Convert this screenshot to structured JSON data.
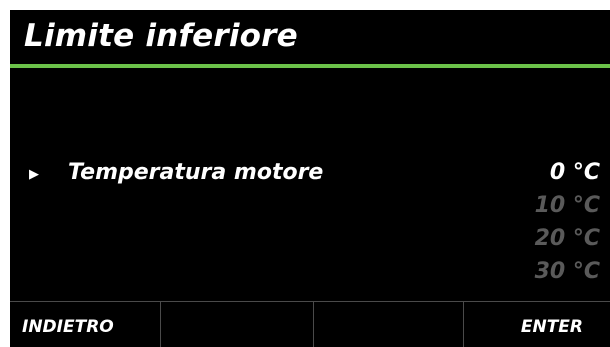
{
  "header": {
    "title": "Limite inferiore"
  },
  "colors": {
    "background": "#000000",
    "accent_line": "#6cc24a",
    "text": "#ffffff",
    "text_dimmed": "#5a5a5a"
  },
  "menu": {
    "pointer_icon": "triangle-right-icon",
    "item_label": "Temperatura motore"
  },
  "values": {
    "selected": "0 °C",
    "options": [
      "10 °C",
      "20 °C",
      "30 °C"
    ]
  },
  "softkeys": {
    "key1": "INDIETRO",
    "key2": "",
    "key3": "",
    "key4": "ENTER"
  }
}
